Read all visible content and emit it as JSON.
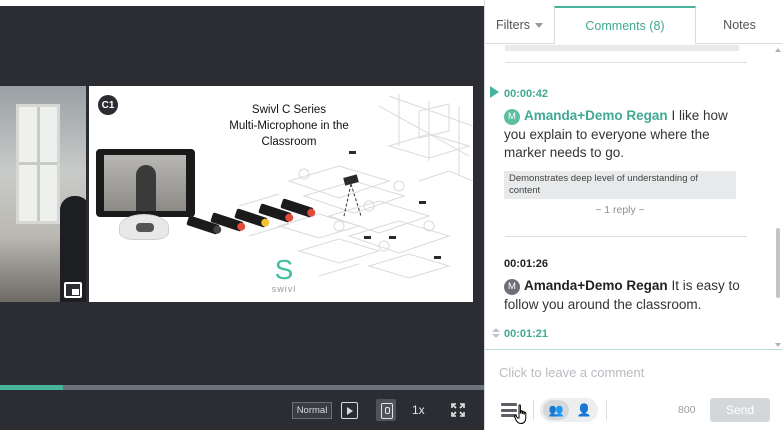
{
  "player": {
    "slide_title": "Swivl C Series\nMulti-Microphone in the\nClassroom",
    "camera_badge": "C1",
    "logo_letter": "S",
    "logo_word": "swivl",
    "progress": 0.13,
    "playback_mode": "Normal",
    "speed": "1x",
    "icons": [
      "picture-in-picture-icon",
      "play-icon",
      "camera-switch-icon",
      "fullscreen-icon"
    ]
  },
  "panel": {
    "tabs": {
      "filters": "Filters",
      "comments": "Comments (8)",
      "notes": "Notes"
    },
    "comments": [
      {
        "time": "00:00:42",
        "avatar": "M",
        "author": "Amanda+Demo Regan",
        "text": "I like how you explain to everyone where the marker needs to go.",
        "tag": "Demonstrates deep level of understanding of content",
        "replies": "~ 1 reply ~"
      },
      {
        "time": "00:01:26",
        "avatar": "M",
        "author": "Amanda+Demo Regan",
        "text": "It is easy to follow you around the classroom."
      }
    ],
    "current_timestamp": "00:01:21",
    "compose": {
      "placeholder": "Click to leave a comment",
      "char_count": "800",
      "send_label": "Send"
    }
  },
  "colors": {
    "accent": "#46b39a",
    "player_bg": "#2b2d33"
  }
}
